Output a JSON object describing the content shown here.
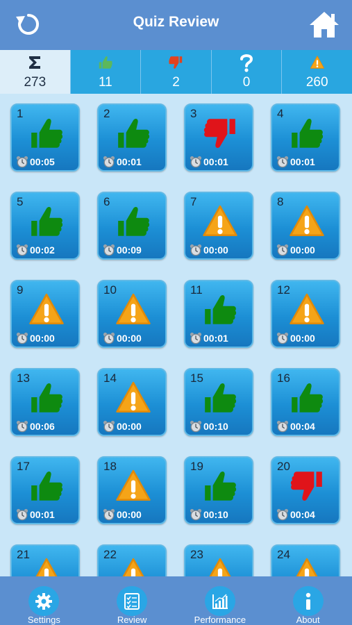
{
  "header": {
    "title": "Quiz Review"
  },
  "stats": [
    {
      "icon": "sigma-icon",
      "value": "273"
    },
    {
      "icon": "thumbs-up-icon",
      "value": "11"
    },
    {
      "icon": "thumbs-down-icon",
      "value": "2"
    },
    {
      "icon": "question-mark-icon",
      "value": "0"
    },
    {
      "icon": "warning-icon",
      "value": "260"
    }
  ],
  "questions": [
    {
      "num": "1",
      "status": "correct",
      "time": "00:05"
    },
    {
      "num": "2",
      "status": "correct",
      "time": "00:01"
    },
    {
      "num": "3",
      "status": "wrong",
      "time": "00:01"
    },
    {
      "num": "4",
      "status": "correct",
      "time": "00:01"
    },
    {
      "num": "5",
      "status": "correct",
      "time": "00:02"
    },
    {
      "num": "6",
      "status": "correct",
      "time": "00:09"
    },
    {
      "num": "7",
      "status": "unanswered",
      "time": "00:00"
    },
    {
      "num": "8",
      "status": "unanswered",
      "time": "00:00"
    },
    {
      "num": "9",
      "status": "unanswered",
      "time": "00:00"
    },
    {
      "num": "10",
      "status": "unanswered",
      "time": "00:00"
    },
    {
      "num": "11",
      "status": "correct",
      "time": "00:01"
    },
    {
      "num": "12",
      "status": "unanswered",
      "time": "00:00"
    },
    {
      "num": "13",
      "status": "correct",
      "time": "00:06"
    },
    {
      "num": "14",
      "status": "unanswered",
      "time": "00:00"
    },
    {
      "num": "15",
      "status": "correct",
      "time": "00:10"
    },
    {
      "num": "16",
      "status": "correct",
      "time": "00:04"
    },
    {
      "num": "17",
      "status": "correct",
      "time": "00:01"
    },
    {
      "num": "18",
      "status": "unanswered",
      "time": "00:00"
    },
    {
      "num": "19",
      "status": "correct",
      "time": "00:10"
    },
    {
      "num": "20",
      "status": "wrong",
      "time": "00:04"
    },
    {
      "num": "21",
      "status": "unanswered",
      "time": ""
    },
    {
      "num": "22",
      "status": "unanswered",
      "time": ""
    },
    {
      "num": "23",
      "status": "unanswered",
      "time": ""
    },
    {
      "num": "24",
      "status": "unanswered",
      "time": ""
    }
  ],
  "tabs": [
    {
      "label": "Settings",
      "icon": "gear-icon"
    },
    {
      "label": "Review",
      "icon": "checklist-icon"
    },
    {
      "label": "Performance",
      "icon": "bar-chart-icon"
    },
    {
      "label": "About",
      "icon": "info-icon"
    }
  ],
  "colors": {
    "correct": "#0e8a10",
    "wrong": "#e0141a",
    "warning": "#f5a418",
    "header": "#5b8fd0",
    "statbar": "#29a6e0"
  }
}
